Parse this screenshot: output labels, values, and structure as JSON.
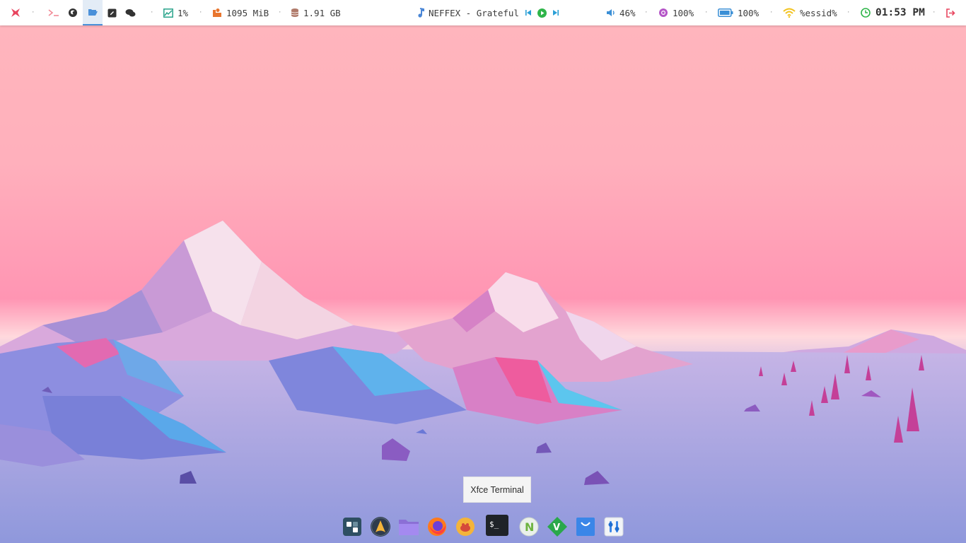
{
  "topbar": {
    "workspaces": [
      {
        "name": "logo",
        "icon": "xfce-logo-icon",
        "color": "#e8455f"
      },
      {
        "name": "terminal",
        "icon": "terminal-icon",
        "color": "#f28a96"
      },
      {
        "name": "browser",
        "icon": "browser-icon",
        "color": "#333333"
      },
      {
        "name": "files",
        "icon": "folder-open-icon",
        "color": "#4a90d9",
        "active": true
      },
      {
        "name": "editor",
        "icon": "edit-icon",
        "color": "#333333"
      },
      {
        "name": "chat",
        "icon": "chat-icon",
        "color": "#333333"
      }
    ],
    "separator": "·",
    "cpu": {
      "value": "1%",
      "icon": "cpu-chart-icon",
      "color": "#28a38a"
    },
    "memory": {
      "value": "1095 MiB",
      "icon": "memory-icon",
      "color": "#e8762f"
    },
    "disk": {
      "value": "1.91 GB",
      "icon": "disk-icon",
      "color": "#b07a6a"
    },
    "media": {
      "track": "NEFFEX - Grateful",
      "note_color": "#4a86d6",
      "controls_color": "#2a9fd6",
      "play_color": "#2fb54a"
    },
    "volume": {
      "value": "46%",
      "icon": "speaker-icon",
      "color": "#3b8fd6"
    },
    "brightness": {
      "value": "100%",
      "icon": "brightness-icon",
      "color": "#b455c7"
    },
    "battery": {
      "value": "100%",
      "icon": "battery-icon",
      "color": "#3b8fd6"
    },
    "wifi": {
      "value": "%essid%",
      "icon": "wifi-icon",
      "color": "#f2c21b"
    },
    "clock": {
      "value": "01:53 PM",
      "icon": "clock-icon",
      "color": "#2fb54a"
    },
    "power": {
      "icon": "logout-icon",
      "color": "#e8455f"
    }
  },
  "tooltip": {
    "text": "Xfce Terminal"
  },
  "dock": [
    {
      "name": "workspace-switcher",
      "icon": "workspaces-icon"
    },
    {
      "name": "arch-linux",
      "icon": "arch-icon"
    },
    {
      "name": "file-manager",
      "icon": "folder-icon"
    },
    {
      "name": "firefox",
      "icon": "firefox-icon"
    },
    {
      "name": "app",
      "icon": "app-icon"
    },
    {
      "name": "terminal",
      "icon": "terminal-icon",
      "glyph": "$_"
    },
    {
      "name": "nodejs",
      "icon": "node-icon",
      "glyph": "N"
    },
    {
      "name": "vim",
      "icon": "vim-icon",
      "glyph": "V"
    },
    {
      "name": "store",
      "icon": "bag-icon"
    },
    {
      "name": "settings",
      "icon": "settings-icon"
    }
  ]
}
